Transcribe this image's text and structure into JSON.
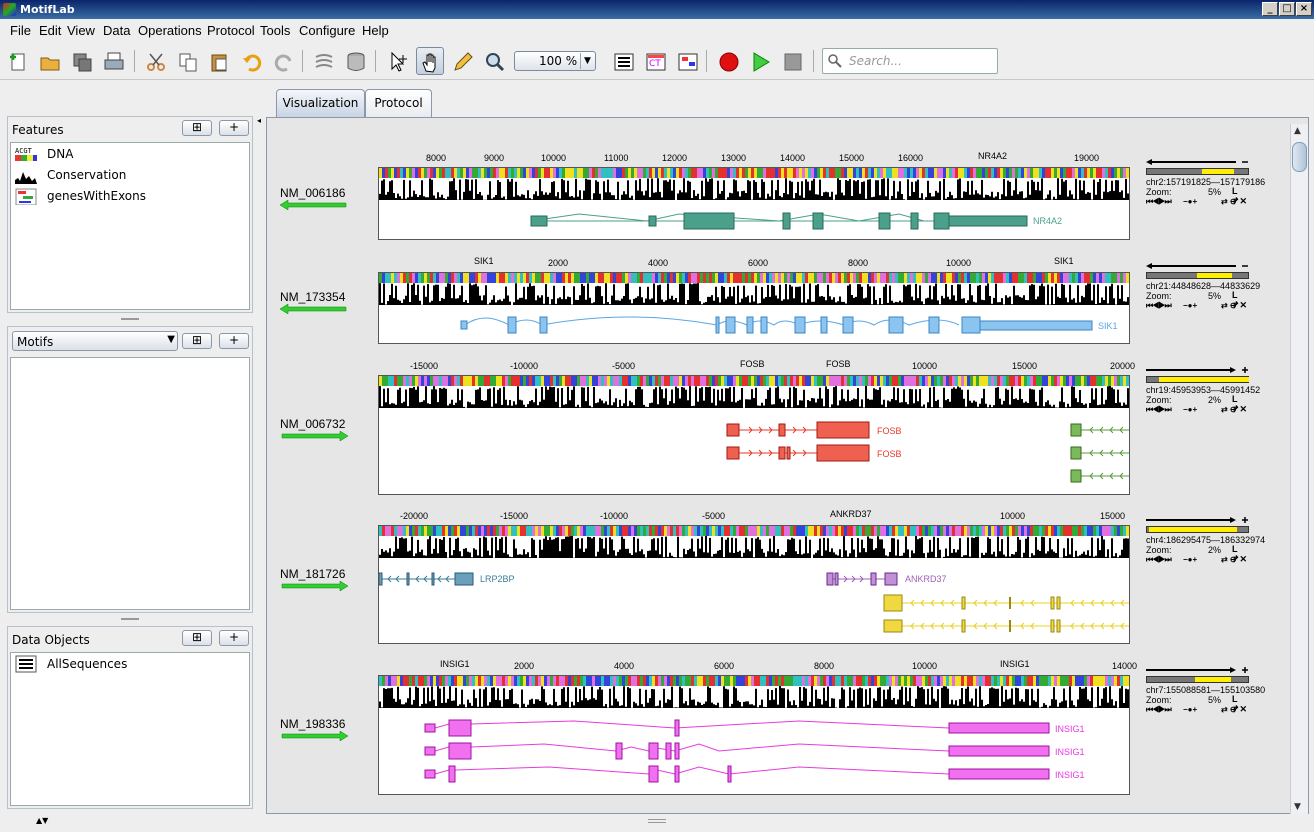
{
  "window": {
    "title": "MotifLab"
  },
  "menu": [
    "File",
    "Edit",
    "View",
    "Data",
    "Operations",
    "Protocol",
    "Tools",
    "Configure",
    "Help"
  ],
  "toolbar": {
    "zoom": "100 %",
    "search_placeholder": "Search..."
  },
  "panels": {
    "features": {
      "title": "Features",
      "items": [
        "DNA",
        "Conservation",
        "genesWithExons"
      ]
    },
    "motifs": {
      "title": "Motifs",
      "dropdown": "Motifs"
    },
    "data_objects": {
      "title": "Data Objects",
      "items": [
        "AllSequences"
      ]
    },
    "btn_tree": "⊞",
    "btn_add": "+"
  },
  "tabs": [
    "Visualization",
    "Protocol"
  ],
  "sequences": [
    {
      "name": "NM_006186",
      "ticks": [
        "8000",
        "9000",
        "10000",
        "11000",
        "12000",
        "13000",
        "14000",
        "15000",
        "16000",
        "19000"
      ],
      "markers": [
        "NR4A2"
      ],
      "genes": [
        "NR4A2"
      ],
      "coord": "chr2:157191825—157179186",
      "zoom": "5%",
      "strand": "minus"
    },
    {
      "name": "NM_173354",
      "ticks": [
        "2000",
        "4000",
        "6000",
        "8000",
        "10000"
      ],
      "markers": [
        "SIK1",
        "SIK1"
      ],
      "genes": [
        "SIK1"
      ],
      "coord": "chr21:44848628—44833629",
      "zoom": "5%",
      "strand": "minus"
    },
    {
      "name": "NM_006732",
      "ticks": [
        "-15000",
        "-10000",
        "-5000",
        "10000",
        "15000",
        "20000"
      ],
      "markers": [
        "FOSB",
        "FOSB"
      ],
      "genes": [
        "FOSB",
        "FOSB"
      ],
      "coord": "chr19:45953953—45991452",
      "zoom": "2%",
      "strand": "plus"
    },
    {
      "name": "NM_181726",
      "ticks": [
        "-20000",
        "-15000",
        "-10000",
        "-5000",
        "10000",
        "15000"
      ],
      "markers": [
        "ANKRD37"
      ],
      "genes": [
        "LRP2BP",
        "ANKRD37"
      ],
      "coord": "chr4:186295475—186332974",
      "zoom": "2%",
      "strand": "plus"
    },
    {
      "name": "NM_198336",
      "ticks": [
        "2000",
        "4000",
        "6000",
        "8000",
        "10000",
        "14000"
      ],
      "markers": [
        "INSIG1",
        "INSIG1"
      ],
      "genes": [
        "INSIG1",
        "INSIG1",
        "INSIG1"
      ],
      "coord": "chr7:155088581—155103580",
      "zoom": "5%",
      "strand": "plus"
    }
  ],
  "labels": {
    "zoom": "Zoom:"
  },
  "colors": {
    "nr4a2": "#4aa08a",
    "sik1": "#5aa6e6",
    "fosb": "#e83a2a",
    "green_gene": "#5a9a3a",
    "lrp2bp": "#3a7c9a",
    "ankrd37": "#a060b8",
    "yellow_gene": "#e8d020",
    "insig1": "#e83ae0",
    "seq_arrow": "#33cc33"
  }
}
